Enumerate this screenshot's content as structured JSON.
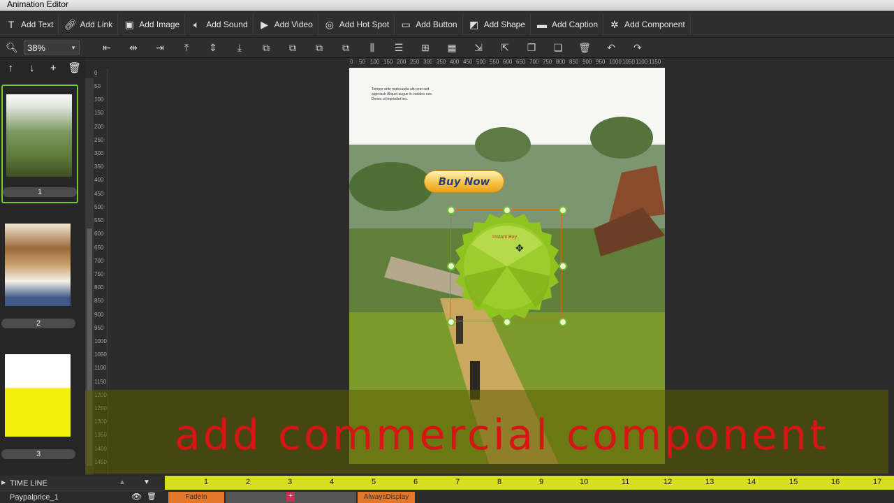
{
  "window": {
    "title": "Animation Editor"
  },
  "toolbar": {
    "add_text": "Add Text",
    "add_link": "Add Link",
    "add_image": "Add Image",
    "add_sound": "Add Sound",
    "add_video": "Add Video",
    "add_hot_spot": "Add Hot Spot",
    "add_button": "Add Button",
    "add_shape": "Add Shape",
    "add_caption": "Add Caption",
    "add_component": "Add Component"
  },
  "zoom": {
    "value": "38%"
  },
  "pages": [
    {
      "label": "1"
    },
    {
      "label": "2"
    },
    {
      "label": "3"
    }
  ],
  "ruler": {
    "horizontal": [
      "0",
      "50",
      "100",
      "150",
      "200",
      "250",
      "300",
      "350",
      "400",
      "450",
      "500",
      "550",
      "600",
      "650",
      "700",
      "750",
      "800",
      "850",
      "900",
      "950",
      "1000",
      "1050",
      "1100",
      "1150"
    ],
    "vertical": [
      "0",
      "50",
      "100",
      "150",
      "200",
      "250",
      "300",
      "350",
      "400",
      "450",
      "500",
      "550",
      "600",
      "650",
      "700",
      "750",
      "800",
      "850",
      "900",
      "950",
      "1000",
      "1050",
      "1100",
      "1150",
      "1200",
      "1250",
      "1300",
      "1350",
      "1400",
      "1450"
    ]
  },
  "canvas": {
    "page_text": "Tempor ante malesuada alio erat sed approach Aliquet augue in sodales nec. Donec ut imperdiet leo.",
    "buy_now": "Buy Now",
    "badge_label": "Instant Buy"
  },
  "caption": {
    "text": "add commercial component"
  },
  "timeline": {
    "title": "TIME LINE",
    "ticks": [
      "1",
      "2",
      "3",
      "4",
      "5",
      "6",
      "7",
      "8",
      "9",
      "10",
      "11",
      "12",
      "13",
      "14",
      "15",
      "16",
      "17"
    ],
    "row_name": "Paypalprice_1",
    "fade_in": "FadeIn",
    "always_display": "AlwaysDisplay"
  },
  "colors": {
    "caption_red": "#d81414",
    "timeline_ruler": "#d6df22",
    "timeline_block": "#e3782b",
    "selection_handle": "#7ab43a"
  }
}
